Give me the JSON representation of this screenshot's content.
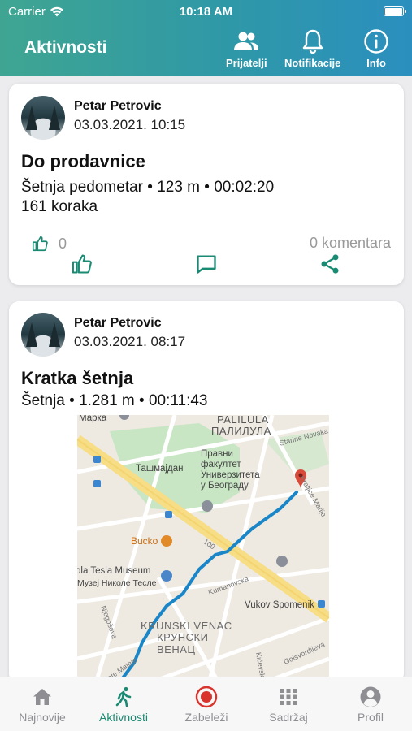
{
  "status": {
    "carrier": "Carrier",
    "time": "10:18 AM"
  },
  "header": {
    "title": "Aktivnosti",
    "buttons": [
      {
        "label": "Prijatelji",
        "icon": "people-icon"
      },
      {
        "label": "Notifikacije",
        "icon": "bell-icon"
      },
      {
        "label": "Info",
        "icon": "info-icon"
      }
    ]
  },
  "posts": [
    {
      "user": "Petar Petrovic",
      "date": "03.03.2021. 10:15",
      "title": "Do prodavnice",
      "line1": "Šetnja pedometar • 123 m • 00:02:20",
      "line2": "161 koraka",
      "likes": "0",
      "comments": "0 komentara"
    },
    {
      "user": "Petar Petrovic",
      "date": "03.03.2021. 08:17",
      "title": "Kratka šetnja",
      "line1": "Šetnja • 1.281 m • 00:11:43"
    }
  ],
  "map": {
    "labels": {
      "marka": "Марка",
      "palilula_lat": "PALILULA",
      "palilula_cyr": "ПАЛИЛУЛА",
      "starine": "Starine Novaka",
      "tasmajdan": "Ташмајдан",
      "faculty": "Правни\nфакултет\nУниверзитета\nу Београду",
      "kraljice": "Kraljice Marije",
      "bucko": "Bucko",
      "tesla_lat": "ola Tesla Museum",
      "tesla_cyr": "Музеј Николе Тесле",
      "road100": "100",
      "kumanovska": "Kumanovska",
      "vukov": "Vukov Spomenik",
      "njegoseva": "Njegoševa",
      "krunski_lat": "KRUNSKI VENAC",
      "krunski_cyr": "КРУНСКИ\nВЕНАЦ",
      "golsvorijeva": "Golsvordijeva",
      "kicevska": "Kičevska",
      "prote": "Prote Mateje"
    }
  },
  "tabs": [
    {
      "label": "Najnovije",
      "icon": "home-icon"
    },
    {
      "label": "Aktivnosti",
      "icon": "walker-icon"
    },
    {
      "label": "Zabeleži",
      "icon": "record-icon"
    },
    {
      "label": "Sadržaj",
      "icon": "grid-icon"
    },
    {
      "label": "Profil",
      "icon": "profile-icon"
    }
  ],
  "colors": {
    "accent": "#1a8a73",
    "record": "#d8332c",
    "route": "#1a86c7",
    "pin": "#d84a3a"
  }
}
